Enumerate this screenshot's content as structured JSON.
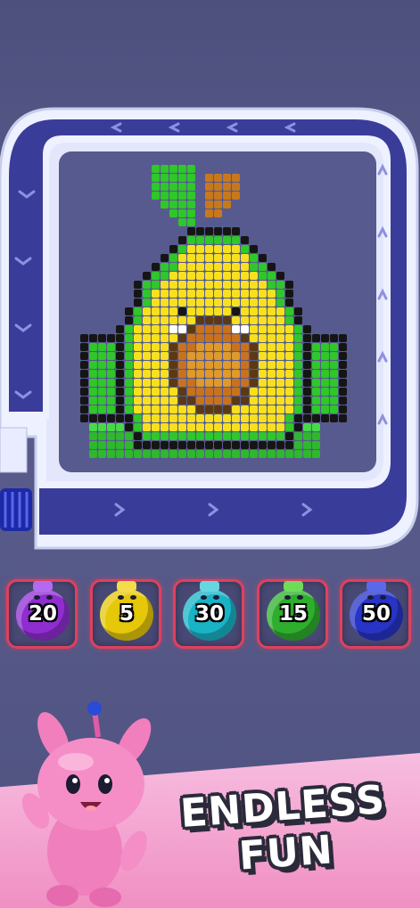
{
  "game": {
    "colors": {
      "track_rail": "#eef1ff",
      "track_lane": "#3a3c9a",
      "board": "#575a8e",
      "avocado_skin": "#2fc72a",
      "avocado_flesh": "#f6e020",
      "pit": "#c9721e",
      "outline": "#151515"
    },
    "track_arrow_icon": "chevron-icon"
  },
  "dock": {
    "jars": [
      {
        "value": "20",
        "color": "#8f2ed0",
        "lid": "#b36af0"
      },
      {
        "value": "5",
        "color": "#e6c80a",
        "lid": "#f3dd4a"
      },
      {
        "value": "30",
        "color": "#1ab3c6",
        "lid": "#66d6e3"
      },
      {
        "value": "15",
        "color": "#2fae2e",
        "lid": "#6edc5a"
      },
      {
        "value": "50",
        "color": "#2734c6",
        "lid": "#5a68ea"
      }
    ]
  },
  "promo": {
    "line1": "ENDLESS",
    "line2": "FUN"
  }
}
